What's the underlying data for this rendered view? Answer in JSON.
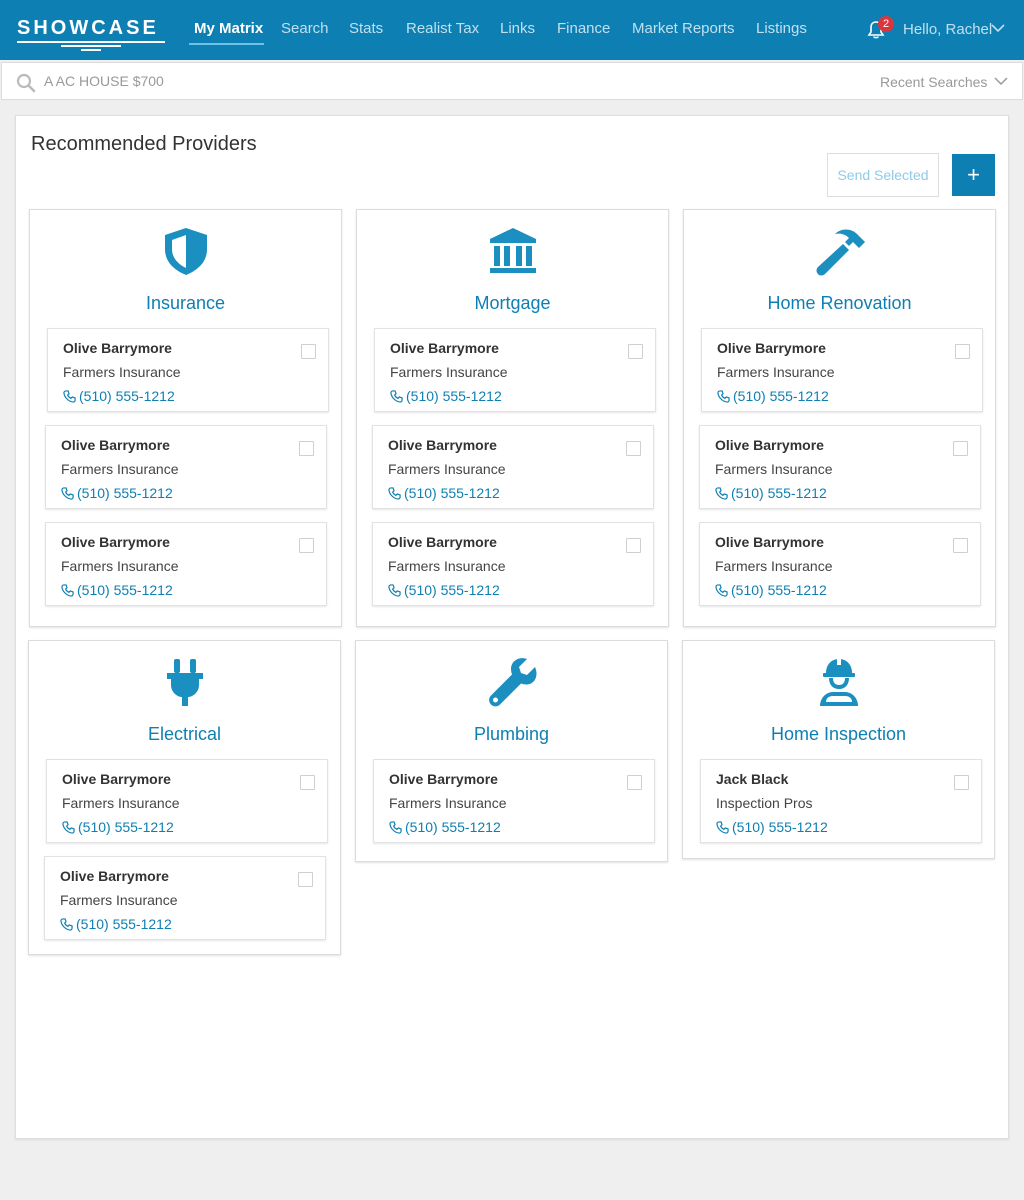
{
  "brand": {
    "logo_text": "SHOWCASE"
  },
  "nav": {
    "items": [
      "My Matrix",
      "Search",
      "Stats",
      "Realist Tax",
      "Links",
      "Finance",
      "Market Reports",
      "Listings"
    ],
    "active": "My Matrix"
  },
  "user": {
    "greeting": "Hello, Rachel",
    "notification_count": "2"
  },
  "search": {
    "value": "A AC HOUSE $700",
    "recent_label": "Recent Searches"
  },
  "panel": {
    "title": "Recommended Providers",
    "send_label": "Send Selected",
    "add_label": "+"
  },
  "colors": {
    "brand": "#0e7fb3",
    "badge": "#d9363e",
    "icon": "#1b8fbf"
  },
  "categories": [
    {
      "title": "Insurance",
      "icon": "shield-icon",
      "providers": [
        {
          "name": "Olive Barrymore",
          "company": "Farmers Insurance",
          "phone": "(510) 555-1212"
        },
        {
          "name": "Olive Barrymore",
          "company": "Farmers Insurance",
          "phone": "(510) 555-1212"
        },
        {
          "name": "Olive Barrymore",
          "company": "Farmers Insurance",
          "phone": "(510) 555-1212"
        }
      ]
    },
    {
      "title": "Mortgage",
      "icon": "bank-icon",
      "providers": [
        {
          "name": "Olive Barrymore",
          "company": "Farmers Insurance",
          "phone": "(510) 555-1212"
        },
        {
          "name": "Olive Barrymore",
          "company": "Farmers Insurance",
          "phone": "(510) 555-1212"
        },
        {
          "name": "Olive Barrymore",
          "company": "Farmers Insurance",
          "phone": "(510) 555-1212"
        }
      ]
    },
    {
      "title": "Home Renovation",
      "icon": "hammer-icon",
      "providers": [
        {
          "name": "Olive Barrymore",
          "company": "Farmers Insurance",
          "phone": "(510) 555-1212"
        },
        {
          "name": "Olive Barrymore",
          "company": "Farmers Insurance",
          "phone": "(510) 555-1212"
        },
        {
          "name": "Olive Barrymore",
          "company": "Farmers Insurance",
          "phone": "(510) 555-1212"
        }
      ]
    },
    {
      "title": "Electrical",
      "icon": "plug-icon",
      "providers": [
        {
          "name": "Olive Barrymore",
          "company": "Farmers Insurance",
          "phone": "(510) 555-1212"
        },
        {
          "name": "Olive Barrymore",
          "company": "Farmers Insurance",
          "phone": "(510) 555-1212"
        }
      ]
    },
    {
      "title": "Plumbing",
      "icon": "wrench-icon",
      "providers": [
        {
          "name": "Olive Barrymore",
          "company": "Farmers Insurance",
          "phone": "(510) 555-1212"
        }
      ]
    },
    {
      "title": "Home Inspection",
      "icon": "inspector-icon",
      "providers": [
        {
          "name": "Jack Black",
          "company": "Inspection Pros",
          "phone": "(510) 555-1212"
        }
      ]
    }
  ]
}
